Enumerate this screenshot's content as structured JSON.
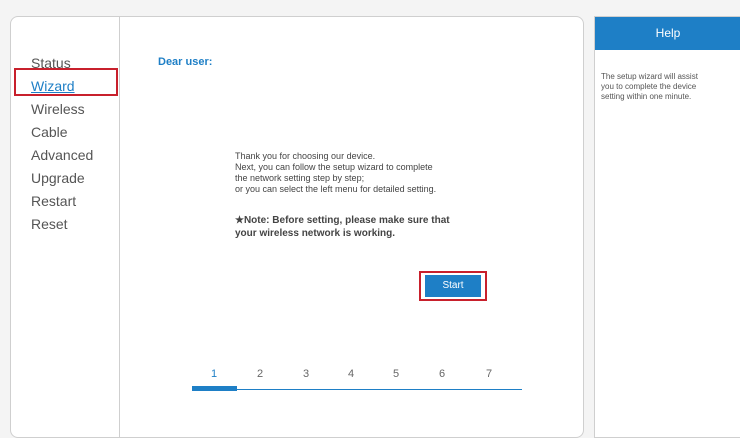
{
  "sidebar": {
    "items": [
      {
        "label": "Status"
      },
      {
        "label": "Wizard"
      },
      {
        "label": "Wireless"
      },
      {
        "label": "Cable"
      },
      {
        "label": "Advanced"
      },
      {
        "label": "Upgrade"
      },
      {
        "label": "Restart"
      },
      {
        "label": "Reset"
      }
    ],
    "active": "Wizard"
  },
  "main": {
    "greeting": "Dear user:",
    "intro_lines": [
      "Thank you for choosing our device.",
      "Next, you can follow the setup wizard to complete",
      "the network setting step by step;",
      "or you can select the left menu for detailed setting."
    ],
    "note_lines": [
      "★Note: Before setting, please make sure that",
      "your wireless network is working."
    ],
    "start_label": "Start",
    "steps": [
      "1",
      "2",
      "3",
      "4",
      "5",
      "6",
      "7"
    ],
    "current_step": "1"
  },
  "help": {
    "title": "Help",
    "text_lines": [
      "The setup wizard will assist",
      "you to complete the device",
      "setting within one minute."
    ]
  },
  "colors": {
    "accent": "#1e7fc6",
    "highlight": "#c8202c"
  }
}
